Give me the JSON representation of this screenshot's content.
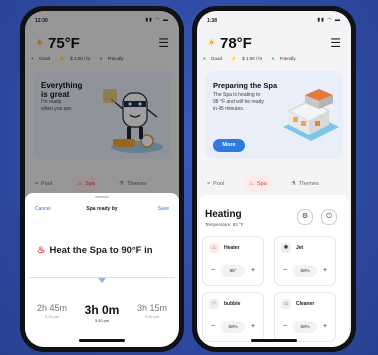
{
  "left_phone": {
    "time": "12:30",
    "signal_glyphs": "▮▮ ◠ ▬",
    "temperature": "75°F",
    "info": {
      "quality": "Good",
      "price": "$ 1.00 / hr",
      "mode": "Friendly"
    },
    "card": {
      "title_line1": "Everything",
      "title_line2": "is great",
      "desc_line1": "I'm ready",
      "desc_line2": "when you are."
    },
    "tabs": {
      "pool": "Pool",
      "spa": "Spa",
      "themes": "Themes"
    },
    "sheet": {
      "cancel": "Cancel",
      "title": "Spa ready by",
      "save": "Save",
      "heat_text": "Heat the Spa to 90°F in",
      "options": [
        {
          "duration": "2h 45m",
          "time": "3:15 pm"
        },
        {
          "duration": "3h 0m",
          "time": "3:30 pm"
        },
        {
          "duration": "3h 15m",
          "time": "3:45 pm"
        }
      ]
    }
  },
  "right_phone": {
    "time": "1:38",
    "signal_glyphs": "▮▮ ◠ ▬",
    "temperature": "78°F",
    "info": {
      "quality": "Good",
      "price": "$ 1.00 / hr",
      "mode": "Friendly"
    },
    "card": {
      "title": "Preparing the Spa",
      "desc_line1": "The Spa is heating to",
      "desc_line2": "98 °F and will be ready",
      "desc_line3": "in 45 minutes.",
      "button": "More"
    },
    "tabs": {
      "pool": "Pool",
      "spa": "Spa",
      "themes": "Themes"
    },
    "heating": {
      "title": "Heating",
      "subtitle": "Temperature: 82 °F",
      "tiles": [
        {
          "name": "Heater",
          "value": "98°",
          "icon": "heater-icon"
        },
        {
          "name": "Jet",
          "value": "50%",
          "icon": "jet-icon"
        },
        {
          "name": "bubble",
          "value": "50%",
          "icon": "bubble-icon"
        },
        {
          "name": "Cleaner",
          "value": "50%",
          "icon": "cleaner-icon"
        }
      ]
    }
  },
  "colors": {
    "accent_red": "#e04545",
    "accent_blue": "#2d7be0",
    "background": "#2f4eaa"
  }
}
